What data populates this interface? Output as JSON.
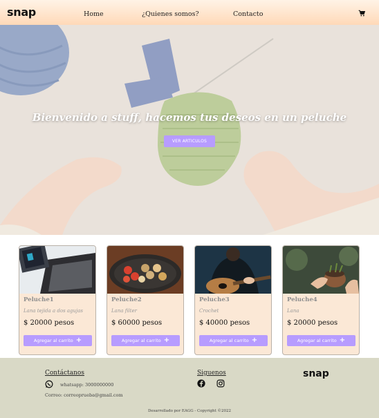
{
  "navbar": {
    "brand": "snap",
    "links": [
      "Home",
      "¿Quienes somos?",
      "Contacto"
    ],
    "cart_icon": "cart-icon"
  },
  "hero": {
    "title": "Bienvenido a stuff, hacemos tus deseos en un peluche",
    "button_label": "VER ARTICULOS"
  },
  "products": [
    {
      "title": "Peluche1",
      "desc": "Lana tejida a dos agujas",
      "price": "$ 20000 pesos",
      "button": "Agregar al carrito"
    },
    {
      "title": "Peluche2",
      "desc": "Lana filter",
      "price": "$ 60000 pesos",
      "button": "Agregar al carrito"
    },
    {
      "title": "Peluche3",
      "desc": "Crochet",
      "price": "$ 40000 pesos",
      "button": "Agregar al carrito"
    },
    {
      "title": "Peluche4",
      "desc": "Lana",
      "price": "$ 20000 pesos",
      "button": "Agregar al carrito"
    }
  ],
  "footer": {
    "contact_heading": "Contáctanos",
    "whatsapp": "whatsapp: 3000000000",
    "email": "Correo: correoprueba@gmail.com",
    "follow_heading": "Siguenos",
    "brand": "snap",
    "copyright": "Desarrollado por EAGG - Copyright ©2022"
  },
  "colors": {
    "accent": "#b79cff",
    "navbar": "#ffd9b8",
    "card_bg": "#fbe8d6",
    "footer_bg": "#d9d9c6"
  }
}
